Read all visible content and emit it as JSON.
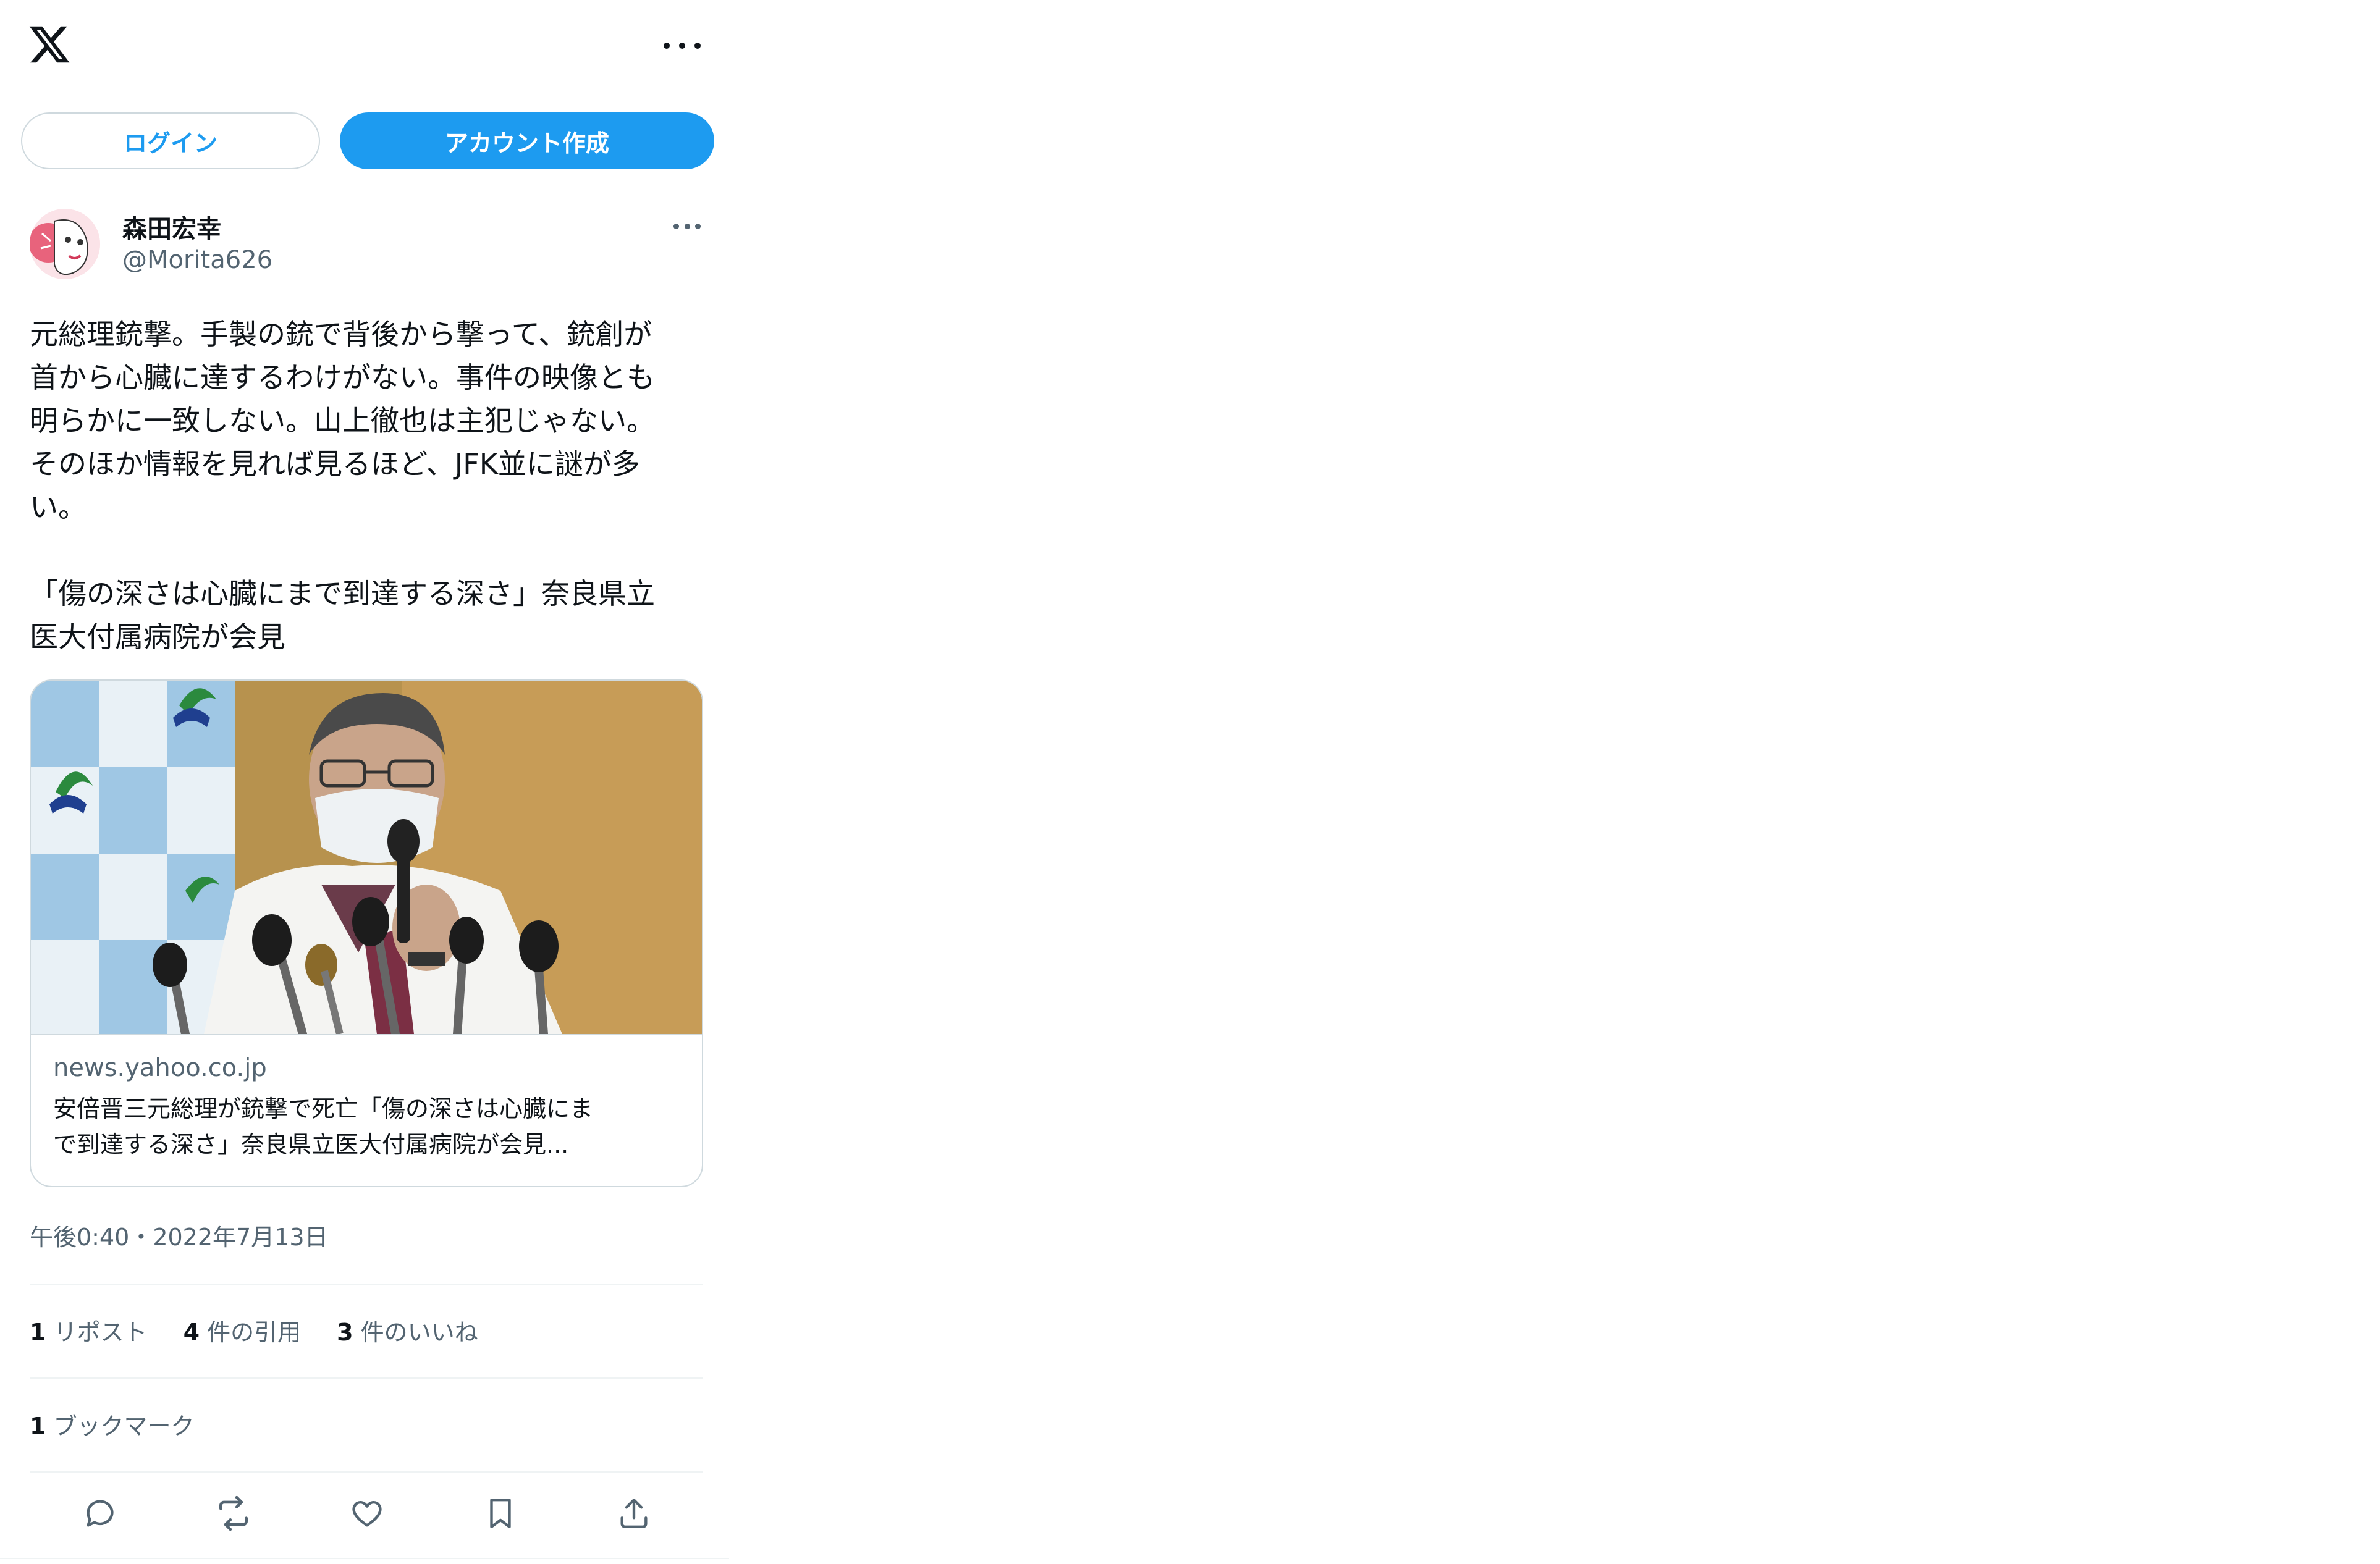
{
  "header": {
    "logo_icon": "x-logo-icon",
    "more_icon": "more-horizontal-icon"
  },
  "auth": {
    "login_label": "ログイン",
    "signup_label": "アカウント作成",
    "accent_color": "#1d9bf0"
  },
  "post": {
    "author_name": "森田宏幸",
    "author_handle": "@Morita626",
    "text": "元総理銃撃。手製の銃で背後から撃って、銃創が\n首から心臓に達するわけがない。事件の映像とも\n明らかに一致しない。山上徹也は主犯じゃない。\nそのほか情報を見れば見るほど、JFK並に謎が多\nい。\n\n「傷の深さは心臓にまで到達する深さ」奈良県立\n医大付属病院が会見",
    "card": {
      "domain": "news.yahoo.co.jp",
      "title": "安倍晋三元総理が銃撃で死亡「傷の深さは心臓にま\nで到達する深さ」奈良県立医大付属病院が会見...",
      "image_description_icon": "press-conference-photo"
    },
    "timestamp": "午後0:40・2022年7月13日",
    "stats": {
      "reposts_count": "1",
      "reposts_label": "リポスト",
      "quotes_count": "4",
      "quotes_label": "件の引用",
      "likes_count": "3",
      "likes_label": "件のいいね"
    },
    "bookmarks": {
      "count": "1",
      "label": "ブックマーク"
    },
    "actions": [
      "reply-icon",
      "repost-icon",
      "like-icon",
      "bookmark-icon",
      "share-icon"
    ]
  }
}
